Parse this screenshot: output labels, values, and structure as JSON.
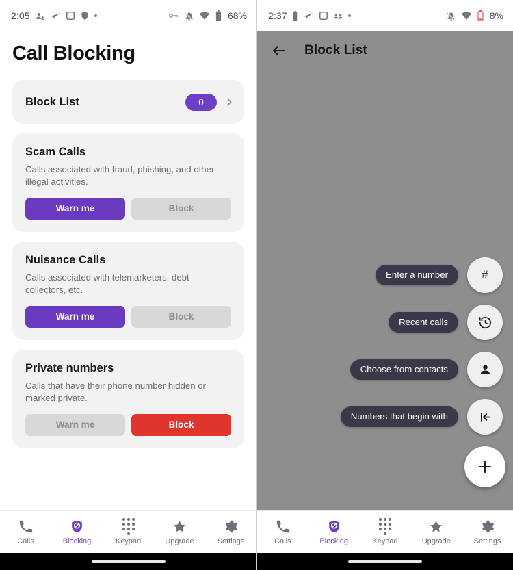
{
  "left": {
    "status_bar": {
      "time": "2:05",
      "left_icons": [
        "contacts-sync-icon",
        "send-icon",
        "square-icon",
        "shield-icon",
        "more-dot-icon"
      ],
      "right_icons": [
        "vpn-key-icon",
        "notifications-off-icon",
        "wifi-warning-icon",
        "battery-icon"
      ],
      "battery": "68%"
    },
    "page_title": "Call Blocking",
    "block_list": {
      "label": "Block List",
      "count": "0",
      "chevron": "chevron-right-icon"
    },
    "cards": [
      {
        "title": "Scam Calls",
        "description": "Calls associated with fraud, phishing, and other illegal activities.",
        "buttons": [
          {
            "label": "Warn me",
            "state": "active-purple"
          },
          {
            "label": "Block",
            "state": "inactive"
          }
        ]
      },
      {
        "title": "Nuisance Calls",
        "description": "Calls associated with telemarketers, debt collectors, etc.",
        "buttons": [
          {
            "label": "Warn me",
            "state": "active-purple"
          },
          {
            "label": "Block",
            "state": "inactive"
          }
        ]
      },
      {
        "title": "Private numbers",
        "description": "Calls that have their phone number hidden or marked private.",
        "buttons": [
          {
            "label": "Warn me",
            "state": "inactive"
          },
          {
            "label": "Block",
            "state": "active-red"
          }
        ]
      }
    ],
    "bottom_nav": [
      {
        "label": "Calls",
        "icon": "phone-icon",
        "active": false
      },
      {
        "label": "Blocking",
        "icon": "block-shield-icon",
        "active": true
      },
      {
        "label": "Keypad",
        "icon": "keypad-icon",
        "active": false
      },
      {
        "label": "Upgrade",
        "icon": "star-icon",
        "active": false
      },
      {
        "label": "Settings",
        "icon": "gear-icon",
        "active": false
      }
    ]
  },
  "right": {
    "status_bar": {
      "time": "2:37",
      "left_icons": [
        "battery-vertical-icon",
        "send-icon",
        "square-icon",
        "people-icon",
        "more-dot-icon"
      ],
      "right_icons": [
        "notifications-off-icon",
        "wifi-icon",
        "battery-low-icon"
      ],
      "battery": "8%"
    },
    "app_bar": {
      "back_icon": "arrow-back-icon",
      "title": "Block List"
    },
    "fab_menu": [
      {
        "label": "Enter a number",
        "icon": "hash-icon",
        "glyph": "#"
      },
      {
        "label": "Recent calls",
        "icon": "history-icon",
        "glyph": ""
      },
      {
        "label": "Choose from contacts",
        "icon": "person-icon",
        "glyph": ""
      },
      {
        "label": "Numbers that begin with",
        "icon": "first-page-icon",
        "glyph": ""
      }
    ],
    "main_fab": {
      "icon": "plus-icon",
      "label": "Add"
    },
    "bottom_nav": [
      {
        "label": "Calls",
        "icon": "phone-icon",
        "active": false
      },
      {
        "label": "Blocking",
        "icon": "block-shield-icon",
        "active": true
      },
      {
        "label": "Keypad",
        "icon": "keypad-icon",
        "active": false
      },
      {
        "label": "Upgrade",
        "icon": "star-icon",
        "active": false
      },
      {
        "label": "Settings",
        "icon": "gear-icon",
        "active": false
      }
    ]
  },
  "colors": {
    "accent_purple": "#6c3fc5",
    "danger_red": "#e0342f",
    "card_bg": "#f2f2f2",
    "inactive_btn": "#d8d8d8",
    "scrim_gray": "#8e8e8e",
    "fab_label_bg": "#3a394a"
  }
}
